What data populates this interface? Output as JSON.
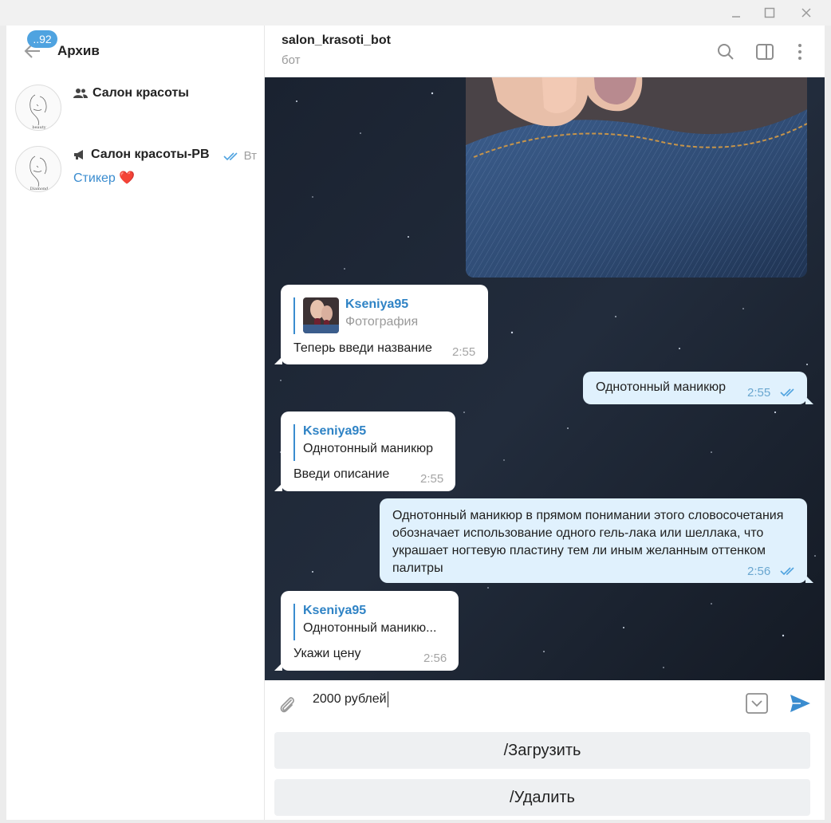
{
  "window": {
    "minimize_icon": "minimize-icon",
    "maximize_icon": "maximize-icon",
    "close_icon": "close-icon"
  },
  "sidebar": {
    "unread_badge": "..92",
    "title": "Архив",
    "chats": [
      {
        "name": "Салон красоты",
        "type_icon": "group-icon",
        "time": "",
        "preview": ""
      },
      {
        "name": "Салон красоты-РВ",
        "type_icon": "channel-icon",
        "time": "Вт",
        "preview": "Стикер",
        "preview_emoji": "❤️"
      }
    ]
  },
  "chat": {
    "peer_name": "salon_krasoti_bot",
    "peer_status": "бот",
    "messages": [
      {
        "direction": "in",
        "reply_name": "Kseniya95",
        "reply_text": "Фотография",
        "text": "Теперь введи название",
        "time": "2:55"
      },
      {
        "direction": "out",
        "text": "Однотонный маникюр",
        "time": "2:55"
      },
      {
        "direction": "in",
        "reply_name": "Kseniya95",
        "reply_text": "Однотонный маникюр",
        "text": "Введи описание",
        "time": "2:55"
      },
      {
        "direction": "out",
        "text": "Однотонный маникюр в прямом понимании этого словосочетания обозначает использование одного гель-лака или шеллака, что украшает ногтевую пластину тем ли иным желанным оттенком палитры",
        "time": "2:56"
      },
      {
        "direction": "in",
        "reply_name": "Kseniya95",
        "reply_text": "Однотонный маникю...",
        "text": "Укажи цену",
        "time": "2:56"
      }
    ]
  },
  "composer": {
    "value": "2000 рублей"
  },
  "bot_keyboard": {
    "buttons": [
      "/Загрузить",
      "/Удалить"
    ]
  },
  "colors": {
    "accent": "#3a8ccf",
    "badge": "#4fa3e0",
    "outgoing_bubble": "#e0f1fd",
    "chat_background": "#1b2433"
  }
}
